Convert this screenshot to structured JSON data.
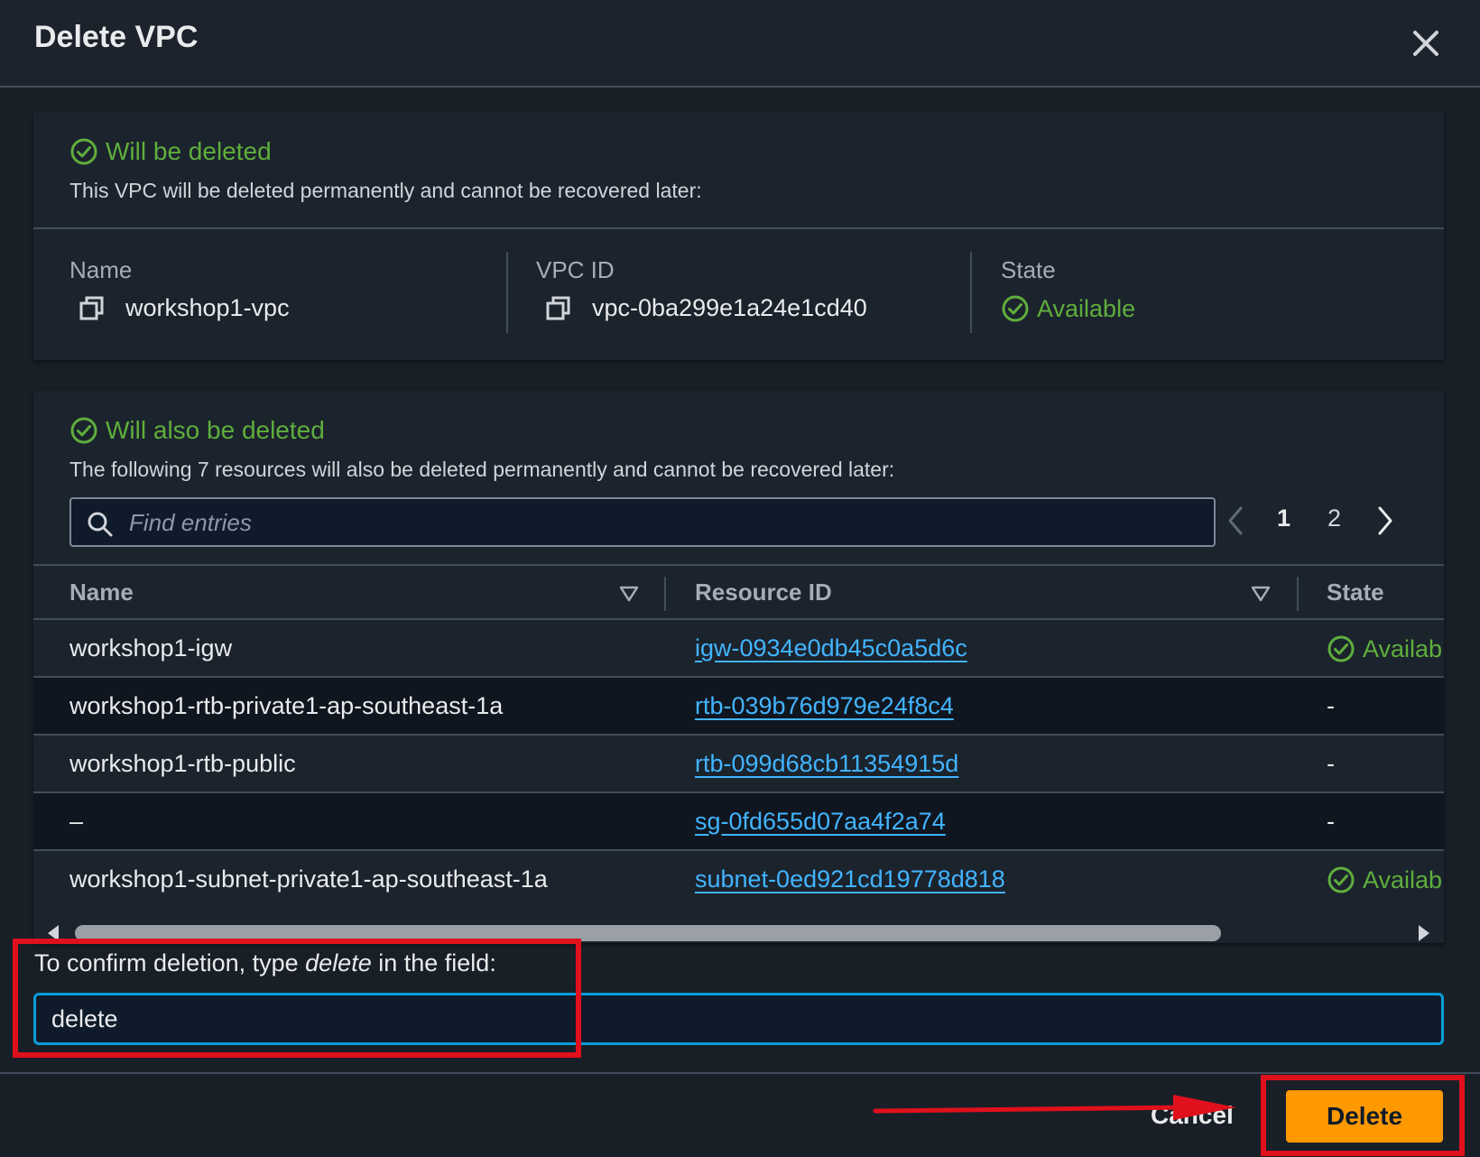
{
  "dialog": {
    "title": "Delete VPC",
    "close_icon": "close-icon"
  },
  "vpc_panel": {
    "title": "Will be deleted",
    "description": "This VPC will be deleted permanently and cannot be recovered later:",
    "name_label": "Name",
    "name_value": "workshop1-vpc",
    "vpcid_label": "VPC ID",
    "vpcid_value": "vpc-0ba299e1a24e1cd40",
    "state_label": "State",
    "state_value": "Available"
  },
  "resources_panel": {
    "title": "Will also be deleted",
    "description": "The following 7 resources will also be deleted permanently and cannot be recovered later:",
    "search_placeholder": "Find entries",
    "pagination": {
      "pages": [
        "1",
        "2"
      ],
      "current": "1"
    },
    "columns": [
      "Name",
      "Resource ID",
      "State"
    ],
    "rows": [
      {
        "name": "workshop1-igw",
        "resource_id": "igw-0934e0db45c0a5d6c",
        "state": "Availab"
      },
      {
        "name": "workshop1-rtb-private1-ap-southeast-1a",
        "resource_id": "rtb-039b76d979e24f8c4",
        "state": "-"
      },
      {
        "name": "workshop1-rtb-public",
        "resource_id": "rtb-099d68cb11354915d",
        "state": "-"
      },
      {
        "name": "–",
        "resource_id": "sg-0fd655d07aa4f2a74",
        "state": "-"
      },
      {
        "name": "workshop1-subnet-private1-ap-southeast-1a",
        "resource_id": "subnet-0ed921cd19778d818",
        "state": "Availab"
      }
    ]
  },
  "confirm": {
    "label_before": "To confirm deletion, type ",
    "label_keyword": "delete",
    "label_after": " in the field:",
    "input_value": "delete"
  },
  "footer": {
    "cancel_label": "Cancel",
    "delete_label": "Delete"
  },
  "colors": {
    "success": "#5fae3c",
    "link": "#42b4ff",
    "primary": "#ff9900",
    "focus": "#0a9dd8",
    "annotation": "#e0101c"
  }
}
